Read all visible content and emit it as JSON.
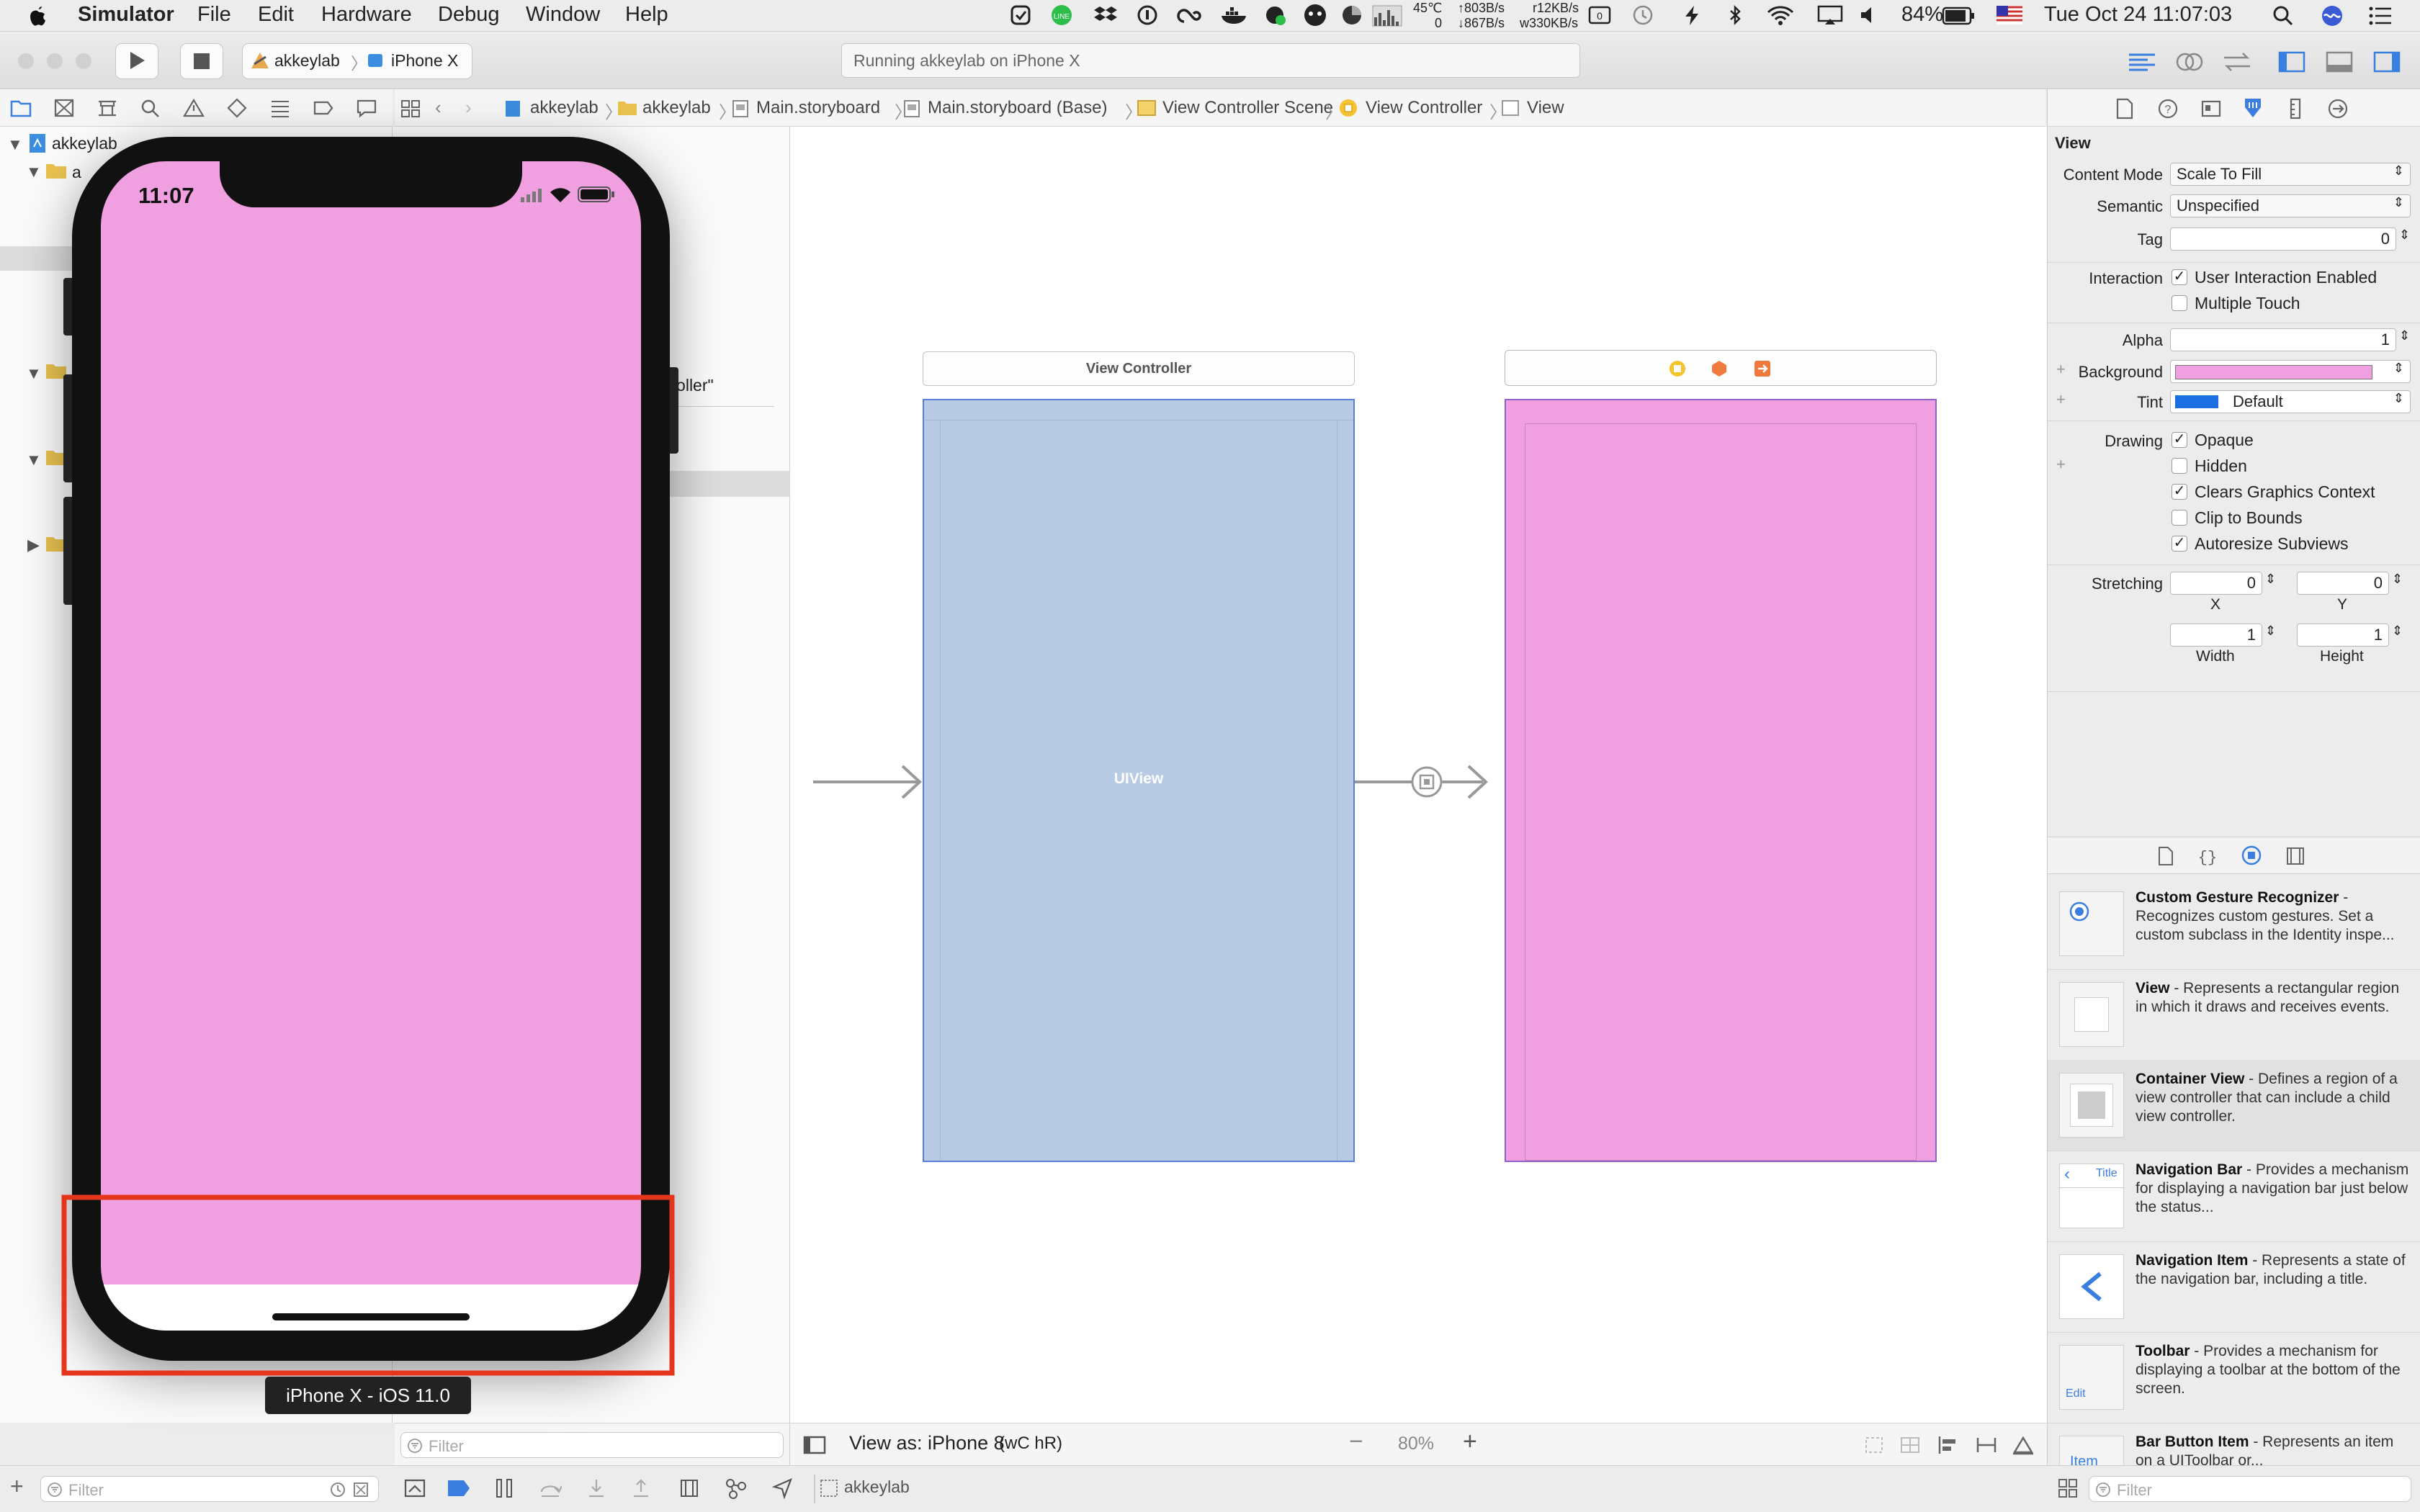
{
  "menubar": {
    "app_name": "Simulator",
    "items": [
      "File",
      "Edit",
      "Hardware",
      "Debug",
      "Window",
      "Help"
    ],
    "status": {
      "temp": "45℃",
      "net_up": "↑803B/s",
      "net_down": "↓867B/s",
      "disk_read": "r12KB/s",
      "disk_write": "w330KB/s",
      "net_zero": "0",
      "battery": "84%",
      "clock": "Tue Oct 24  11:07:03"
    }
  },
  "toolbar": {
    "scheme": "akkeylab",
    "device": "iPhone X",
    "activity": "Running akkeylab on iPhone X"
  },
  "jumpbar": {
    "crumbs": [
      "akkeylab",
      "akkeylab",
      "Main.storyboard",
      "Main.storyboard (Base)",
      "View Controller Scene",
      "View Controller",
      "View"
    ]
  },
  "navigator": {
    "project": "akkeylab",
    "group": "a",
    "filter_placeholder": "Filter"
  },
  "outline": {
    "partial_label": "troller\"",
    "filter_placeholder": "Filter"
  },
  "simulator": {
    "time": "11:07",
    "device_label": "iPhone X - iOS 11.0",
    "screen_color": "#f0a0e0"
  },
  "canvas": {
    "scene1_title": "View Controller",
    "scene1_view_label": "UIView",
    "scene1_color": "#b8cbe4",
    "scene2_color": "#f0a0e0",
    "view_as": "View as: iPhone 8",
    "size_class_w": "wC",
    "size_class_h": "hR",
    "zoom": "80%"
  },
  "inspector": {
    "section_title": "View",
    "content_mode_label": "Content Mode",
    "content_mode": "Scale To Fill",
    "semantic_label": "Semantic",
    "semantic": "Unspecified",
    "tag_label": "Tag",
    "tag": "0",
    "interaction_label": "Interaction",
    "user_interaction": "User Interaction Enabled",
    "multiple_touch": "Multiple Touch",
    "alpha_label": "Alpha",
    "alpha": "1",
    "background_label": "Background",
    "background_color": "#f0a0e0",
    "tint_label": "Tint",
    "tint": "Default",
    "tint_color": "#1c6fe0",
    "drawing_label": "Drawing",
    "opaque": "Opaque",
    "hidden": "Hidden",
    "clears": "Clears Graphics Context",
    "clip": "Clip to Bounds",
    "autoresize": "Autoresize Subviews",
    "stretching_label": "Stretching",
    "stretch_x": "0",
    "stretch_y": "0",
    "x_label": "X",
    "y_label": "Y",
    "stretch_w": "1",
    "stretch_h": "1",
    "width_label": "Width",
    "height_label": "Height",
    "filter_placeholder": "Filter"
  },
  "library": [
    {
      "name": "Custom Gesture Recognizer",
      "desc": "Recognizes custom gestures. Set a custom subclass in the Identity inspe..."
    },
    {
      "name": "View",
      "desc": "Represents a rectangular region in which it draws and receives events."
    },
    {
      "name": "Container View",
      "desc": "Defines a region of a view controller that can include a child view controller."
    },
    {
      "name": "Navigation Bar",
      "desc": "Provides a mechanism for displaying a navigation bar just below the status..."
    },
    {
      "name": "Navigation Item",
      "desc": "Represents a state of the navigation bar, including a title."
    },
    {
      "name": "Toolbar",
      "desc": "Provides a mechanism for displaying a toolbar at the bottom of the screen."
    },
    {
      "name": "Bar Button Item",
      "desc": "Represents an item on a UIToolbar or..."
    }
  ],
  "library_thumb_text": {
    "title": "Title",
    "edit": "Edit",
    "item": "Item"
  },
  "bottom": {
    "target": "akkeylab"
  },
  "dash": " - "
}
